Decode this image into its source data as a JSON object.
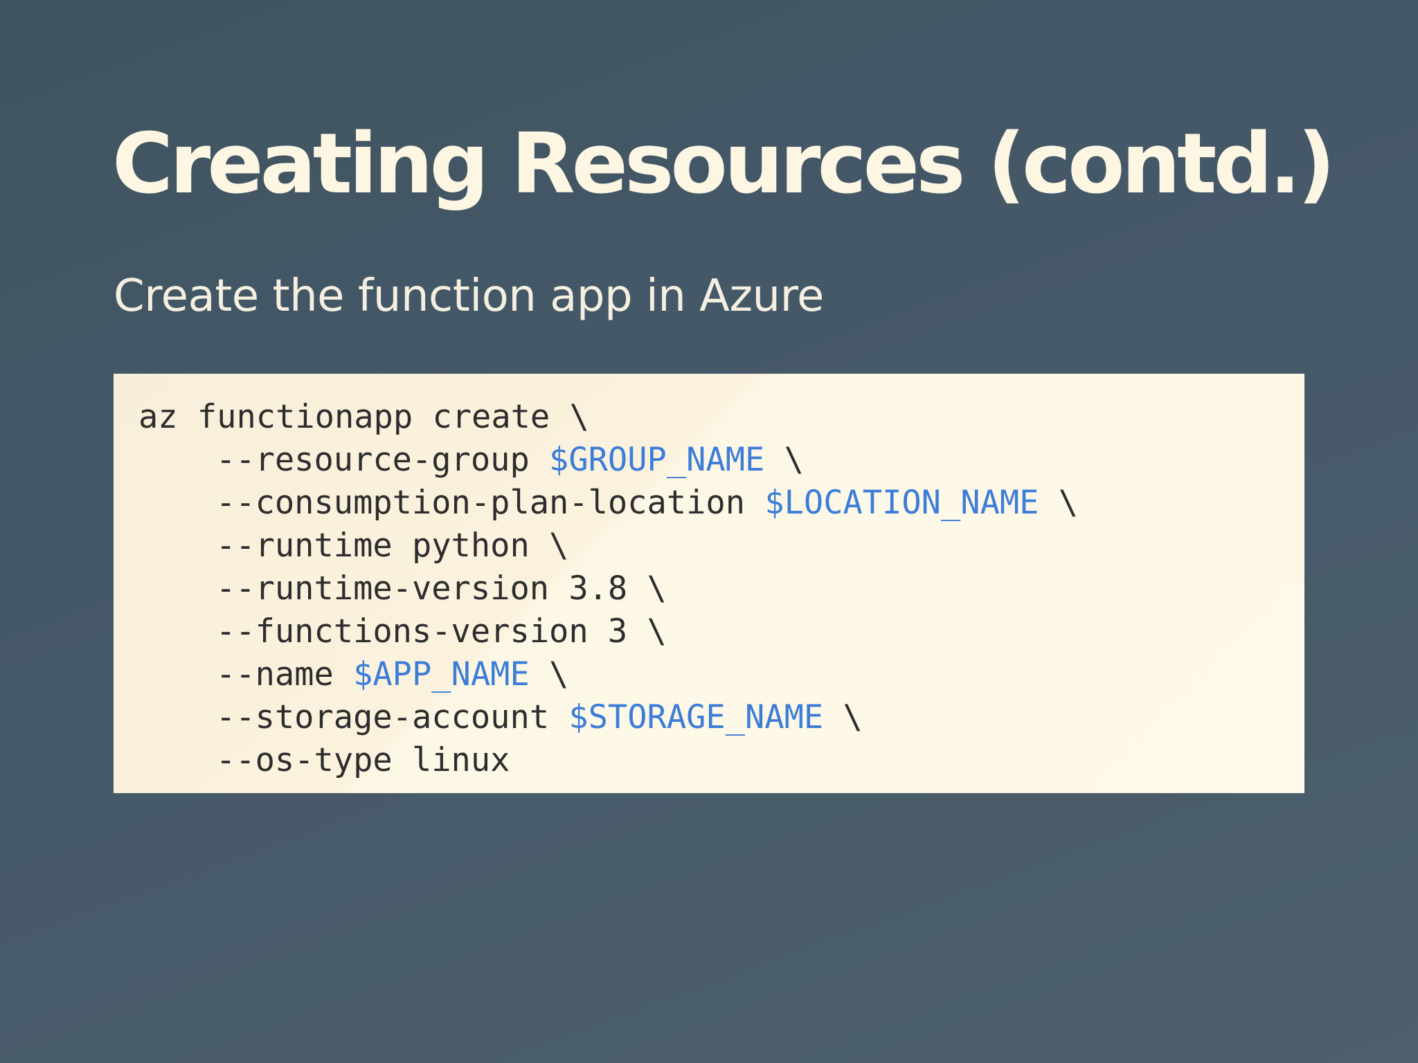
{
  "slide": {
    "title": "Creating Resources (contd.)",
    "subtitle": "Create the function app in Azure"
  },
  "code": {
    "lines": [
      {
        "text": "az functionapp create \\"
      },
      {
        "prefix": "--resource-group ",
        "variable": "$GROUP_NAME",
        "suffix": " \\"
      },
      {
        "prefix": "--consumption-plan-location ",
        "variable": "$LOCATION_NAME",
        "suffix": " \\"
      },
      {
        "text": "--runtime python \\"
      },
      {
        "text": "--runtime-version 3.8 \\"
      },
      {
        "text": "--functions-version 3 \\"
      },
      {
        "prefix": "--name ",
        "variable": "$APP_NAME",
        "suffix": " \\"
      },
      {
        "prefix": "--storage-account ",
        "variable": "$STORAGE_NAME",
        "suffix": " \\"
      },
      {
        "text": "--os-type linux"
      }
    ]
  },
  "colors": {
    "background": "#46596a",
    "title": "#fcf6e3",
    "code_background": "#fdf6e3",
    "code_text": "#2d2d2d",
    "code_variable": "#3b7dd8"
  }
}
